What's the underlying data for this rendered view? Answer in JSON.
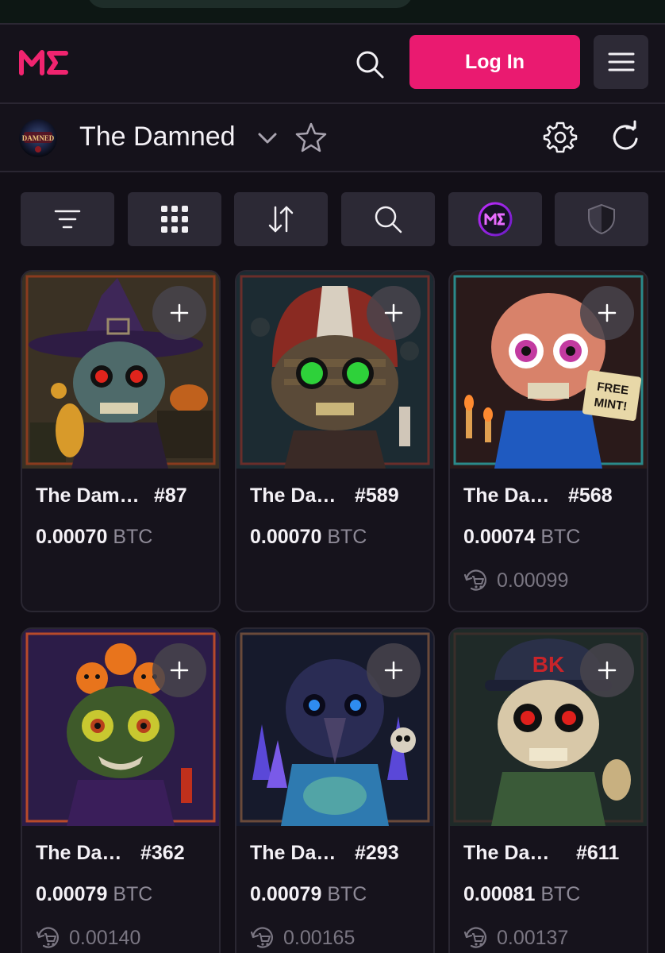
{
  "header": {
    "logo_text": "ME",
    "login_label": "Log In"
  },
  "collection": {
    "name": "The Damned",
    "avatar_text": "THE DAMNED"
  },
  "toolbar": {
    "items": [
      "filter-icon",
      "grid-icon",
      "sort-icon",
      "search-icon",
      "magic-eden-icon",
      "shield-icon"
    ]
  },
  "cards": [
    {
      "name": "The Dam…",
      "number": "#87",
      "price": "0.00070",
      "currency": "BTC",
      "last_sale": ""
    },
    {
      "name": "The Da…",
      "number": "#589",
      "price": "0.00070",
      "currency": "BTC",
      "last_sale": ""
    },
    {
      "name": "The Da…",
      "number": "#568",
      "price": "0.00074",
      "currency": "BTC",
      "last_sale": "0.00099",
      "sign_text": "FREE MINT!"
    },
    {
      "name": "The Da…",
      "number": "#362",
      "price": "0.00079",
      "currency": "BTC",
      "last_sale": "0.00140"
    },
    {
      "name": "The Da…",
      "number": "#293",
      "price": "0.00079",
      "currency": "BTC",
      "last_sale": "0.00165"
    },
    {
      "name": "The Da…",
      "number": "#611",
      "price": "0.00081",
      "currency": "BTC",
      "last_sale": "0.00137",
      "cap_text": "BK"
    }
  ],
  "colors": {
    "accent": "#ea1a70",
    "background": "#120f17",
    "panel": "#2c2935"
  }
}
